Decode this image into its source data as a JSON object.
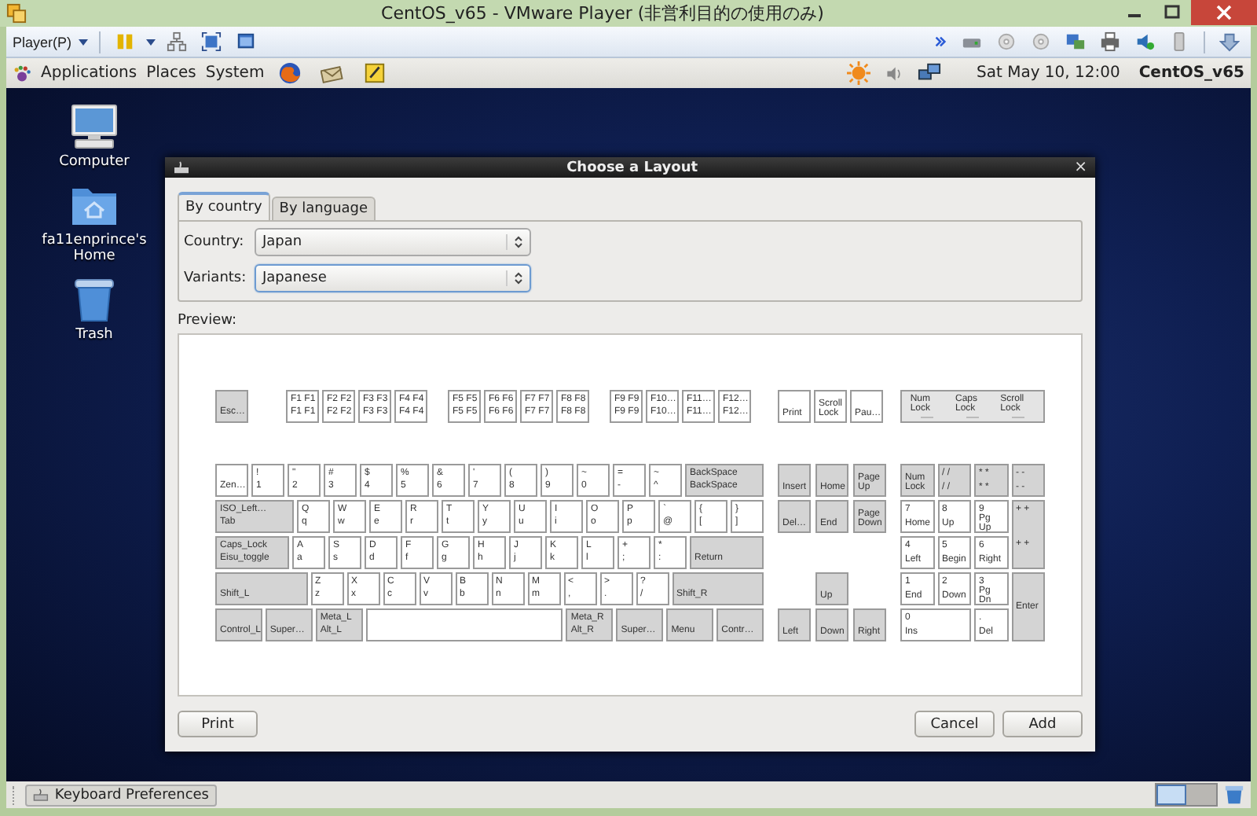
{
  "window": {
    "title": "CentOS_v65 - VMware Player (非営利目的の使用のみ)"
  },
  "toolbar": {
    "player_menu": "Player(P)"
  },
  "top_panel": {
    "menus": [
      "Applications",
      "Places",
      "System"
    ],
    "clock": "Sat May 10, 12:00",
    "user": "CentOS_v65"
  },
  "desktop_icons": [
    {
      "kind": "computer",
      "label": "Computer"
    },
    {
      "kind": "home",
      "label": "fa11enprince's Home"
    },
    {
      "kind": "trash",
      "label": "Trash"
    }
  ],
  "dialog": {
    "title": "Choose a Layout",
    "close": "×",
    "tabs": [
      {
        "label": "By country",
        "selected": true
      },
      {
        "label": "By language",
        "selected": false
      }
    ],
    "fields": [
      {
        "label": "Country:",
        "value": "Japan",
        "focused": false
      },
      {
        "label": "Variants:",
        "value": "Japanese",
        "focused": true
      }
    ],
    "preview_label": "Preview:",
    "keyboard": {
      "function_row": [
        [
          {
            "kind": "mod",
            "labels": [
              "Esc…"
            ]
          }
        ],
        [
          {
            "kind": "char",
            "labels": [
              "F1 F1",
              "F1 F1"
            ]
          },
          {
            "kind": "char",
            "labels": [
              "F2 F2",
              "F2 F2"
            ]
          },
          {
            "kind": "char",
            "labels": [
              "F3 F3",
              "F3 F3"
            ]
          },
          {
            "kind": "char",
            "labels": [
              "F4 F4",
              "F4 F4"
            ]
          }
        ],
        [
          {
            "kind": "char",
            "labels": [
              "F5 F5",
              "F5 F5"
            ]
          },
          {
            "kind": "char",
            "labels": [
              "F6 F6",
              "F6 F6"
            ]
          },
          {
            "kind": "char",
            "labels": [
              "F7 F7",
              "F7 F7"
            ]
          },
          {
            "kind": "char",
            "labels": [
              "F8 F8",
              "F8 F8"
            ]
          }
        ],
        [
          {
            "kind": "char",
            "labels": [
              "F9 F9",
              "F9 F9"
            ]
          },
          {
            "kind": "char",
            "labels": [
              "F10…",
              "F10…"
            ]
          },
          {
            "kind": "char",
            "labels": [
              "F11…",
              "F11…"
            ]
          },
          {
            "kind": "char",
            "labels": [
              "F12…",
              "F12…"
            ]
          }
        ]
      ],
      "system_keys": [
        {
          "kind": "char",
          "labels": [
            "Print"
          ]
        },
        {
          "kind": "char",
          "labels": [
            "Scroll Lock"
          ]
        },
        {
          "kind": "char",
          "labels": [
            "Pau…"
          ]
        }
      ],
      "leds": [
        "Num Lock",
        "Caps Lock",
        "Scroll Lock"
      ],
      "main_rows": [
        [
          {
            "kind": "char",
            "labels": [
              "Zen…"
            ]
          },
          {
            "kind": "char",
            "labels": [
              "!",
              "1"
            ]
          },
          {
            "kind": "char",
            "labels": [
              "\"",
              "2"
            ]
          },
          {
            "kind": "char",
            "labels": [
              "#",
              "3"
            ]
          },
          {
            "kind": "char",
            "labels": [
              "$",
              "4"
            ]
          },
          {
            "kind": "char",
            "labels": [
              "%",
              "5"
            ]
          },
          {
            "kind": "char",
            "labels": [
              "&",
              "6"
            ]
          },
          {
            "kind": "char",
            "labels": [
              "'",
              "7"
            ]
          },
          {
            "kind": "char",
            "labels": [
              "(",
              "8"
            ]
          },
          {
            "kind": "char",
            "labels": [
              ")",
              "9"
            ]
          },
          {
            "kind": "char",
            "labels": [
              "~",
              "0"
            ]
          },
          {
            "kind": "char",
            "labels": [
              "=",
              "-"
            ]
          },
          {
            "kind": "char",
            "labels": [
              "~",
              "^"
            ]
          },
          {
            "kind": "mod",
            "labels": [
              "BackSpace",
              "BackSpace"
            ]
          }
        ],
        [
          {
            "kind": "mod",
            "labels": [
              "ISO_Left…",
              "Tab"
            ]
          },
          {
            "kind": "char",
            "labels": [
              "Q",
              "q"
            ]
          },
          {
            "kind": "char",
            "labels": [
              "W",
              "w"
            ]
          },
          {
            "kind": "char",
            "labels": [
              "E",
              "e"
            ]
          },
          {
            "kind": "char",
            "labels": [
              "R",
              "r"
            ]
          },
          {
            "kind": "char",
            "labels": [
              "T",
              "t"
            ]
          },
          {
            "kind": "char",
            "labels": [
              "Y",
              "y"
            ]
          },
          {
            "kind": "char",
            "labels": [
              "U",
              "u"
            ]
          },
          {
            "kind": "char",
            "labels": [
              "I",
              "i"
            ]
          },
          {
            "kind": "char",
            "labels": [
              "O",
              "o"
            ]
          },
          {
            "kind": "char",
            "labels": [
              "P",
              "p"
            ]
          },
          {
            "kind": "char",
            "labels": [
              "`",
              "@"
            ]
          },
          {
            "kind": "char",
            "labels": [
              "{",
              "["
            ]
          },
          {
            "kind": "char",
            "labels": [
              "}",
              "]"
            ]
          }
        ],
        [
          {
            "kind": "mod",
            "labels": [
              "Caps_Lock",
              "Eisu_toggle"
            ]
          },
          {
            "kind": "char",
            "labels": [
              "A",
              "a"
            ]
          },
          {
            "kind": "char",
            "labels": [
              "S",
              "s"
            ]
          },
          {
            "kind": "char",
            "labels": [
              "D",
              "d"
            ]
          },
          {
            "kind": "char",
            "labels": [
              "F",
              "f"
            ]
          },
          {
            "kind": "char",
            "labels": [
              "G",
              "g"
            ]
          },
          {
            "kind": "char",
            "labels": [
              "H",
              "h"
            ]
          },
          {
            "kind": "char",
            "labels": [
              "J",
              "j"
            ]
          },
          {
            "kind": "char",
            "labels": [
              "K",
              "k"
            ]
          },
          {
            "kind": "char",
            "labels": [
              "L",
              "l"
            ]
          },
          {
            "kind": "char",
            "labels": [
              "+",
              ";"
            ]
          },
          {
            "kind": "char",
            "labels": [
              "*",
              ":"
            ]
          },
          {
            "kind": "mod",
            "labels": [
              "Return"
            ]
          }
        ],
        [
          {
            "kind": "mod",
            "labels": [
              "Shift_L"
            ]
          },
          {
            "kind": "char",
            "labels": [
              "Z",
              "z"
            ]
          },
          {
            "kind": "char",
            "labels": [
              "X",
              "x"
            ]
          },
          {
            "kind": "char",
            "labels": [
              "C",
              "c"
            ]
          },
          {
            "kind": "char",
            "labels": [
              "V",
              "v"
            ]
          },
          {
            "kind": "char",
            "labels": [
              "B",
              "b"
            ]
          },
          {
            "kind": "char",
            "labels": [
              "N",
              "n"
            ]
          },
          {
            "kind": "char",
            "labels": [
              "M",
              "m"
            ]
          },
          {
            "kind": "char",
            "labels": [
              "<",
              ","
            ]
          },
          {
            "kind": "char",
            "labels": [
              ">",
              "."
            ]
          },
          {
            "kind": "char",
            "labels": [
              "?",
              "/"
            ]
          },
          {
            "kind": "mod",
            "labels": [
              "Shift_R"
            ]
          }
        ],
        [
          {
            "kind": "mod",
            "labels": [
              "Control_L"
            ]
          },
          {
            "kind": "mod",
            "labels": [
              "Super…"
            ]
          },
          {
            "kind": "mod",
            "labels": [
              "Meta_L",
              "Alt_L"
            ]
          },
          {
            "kind": "space"
          },
          {
            "kind": "mod",
            "labels": [
              "Meta_R",
              "Alt_R"
            ]
          },
          {
            "kind": "mod",
            "labels": [
              "Super…"
            ]
          },
          {
            "kind": "mod",
            "labels": [
              "Menu"
            ]
          },
          {
            "kind": "mod",
            "labels": [
              "Contr…"
            ]
          }
        ]
      ],
      "nav_rows": [
        [
          {
            "kind": "mod",
            "labels": [
              "Insert"
            ]
          },
          {
            "kind": "mod",
            "labels": [
              "Home"
            ]
          },
          {
            "kind": "mod",
            "labels": [
              "Page Up"
            ]
          }
        ],
        [
          {
            "kind": "mod",
            "labels": [
              "Del…"
            ]
          },
          {
            "kind": "mod",
            "labels": [
              "End"
            ]
          },
          {
            "kind": "mod",
            "labels": [
              "Page Down"
            ]
          }
        ]
      ],
      "arrow_rows": [
        [
          {
            "kind": "mod",
            "labels": [
              "Up"
            ]
          }
        ],
        [
          {
            "kind": "mod",
            "labels": [
              "Left"
            ]
          },
          {
            "kind": "mod",
            "labels": [
              "Down"
            ]
          },
          {
            "kind": "mod",
            "labels": [
              "Right"
            ]
          }
        ]
      ],
      "numpad": [
        {
          "kind": "mod",
          "labels": [
            "Num Lock"
          ]
        },
        {
          "kind": "mod",
          "labels": [
            "/ /",
            "/ /"
          ]
        },
        {
          "kind": "mod",
          "labels": [
            "* *",
            "* *"
          ]
        },
        {
          "kind": "mod",
          "labels": [
            "- -",
            "- -"
          ]
        },
        {
          "kind": "char",
          "labels": [
            "7",
            "Home"
          ]
        },
        {
          "kind": "char",
          "labels": [
            "8",
            "Up"
          ]
        },
        {
          "kind": "char",
          "labels": [
            "9",
            "Pg Up"
          ]
        },
        {
          "kind": "mod-tall",
          "labels": [
            "+ +",
            "+ +"
          ]
        },
        {
          "kind": "char",
          "labels": [
            "4",
            "Left"
          ]
        },
        {
          "kind": "char",
          "labels": [
            "5",
            "Begin"
          ]
        },
        {
          "kind": "char",
          "labels": [
            "6",
            "Right"
          ]
        },
        {
          "kind": "char",
          "labels": [
            "1",
            "End"
          ]
        },
        {
          "kind": "char",
          "labels": [
            "2",
            "Down"
          ]
        },
        {
          "kind": "char",
          "labels": [
            "3",
            "Pg Dn"
          ]
        },
        {
          "kind": "mod-tall",
          "labels": [
            "Enter"
          ]
        },
        {
          "kind": "char-wide",
          "labels": [
            "0",
            "Ins"
          ]
        },
        {
          "kind": "char",
          "labels": [
            ".",
            "Del"
          ]
        }
      ]
    },
    "buttons": [
      {
        "label": "Print"
      },
      {
        "label": "Cancel"
      },
      {
        "label": "Add"
      }
    ]
  },
  "bottom_panel": {
    "tasks": [
      {
        "label": "Keyboard Preferences"
      }
    ],
    "workspaces": [
      {
        "selected": true
      },
      {
        "selected": false
      }
    ]
  }
}
